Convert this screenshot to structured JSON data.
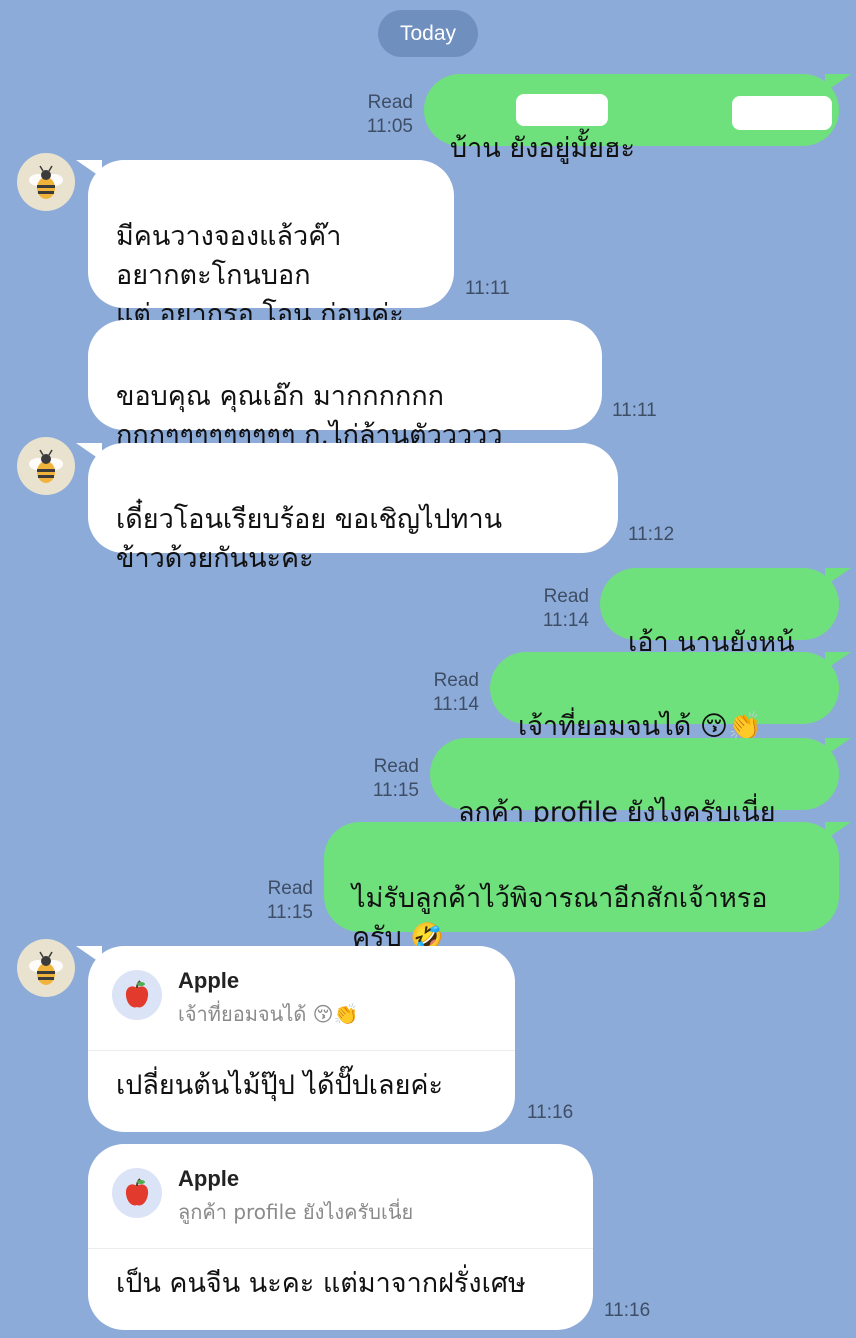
{
  "chat": {
    "date_label": "Today",
    "avatar_icon": "bee-avatar",
    "messages": [
      {
        "id": "m1",
        "direction": "out",
        "text": "บ้าน         ยังอยู่มั้ยฮะ",
        "status": "Read",
        "time": "11:05"
      },
      {
        "id": "m2",
        "direction": "in",
        "text": "มีคนวางจองแล้วค๊า\nอยากตะโกนบอก\nแต่ อยากรอ โอน ก่อนค่ะ",
        "time": "11:11"
      },
      {
        "id": "m3",
        "direction": "in",
        "text": "ขอบคุณ คุณเอ๊ก มากกกกกก\nกกกๆๆๆๆๆๆๆๆๆ ก.ไก่ล้านตัววววว",
        "time": "11:11"
      },
      {
        "id": "m4",
        "direction": "in",
        "text": "เดี๋ยวโอนเรียบร้อย        ขอเชิญไปทาน\nข้าวด้วยกันนะคะ",
        "time": "11:12"
      },
      {
        "id": "m5",
        "direction": "out",
        "text": "เอ้า นานยังหน้",
        "status": "Read",
        "time": "11:14"
      },
      {
        "id": "m6",
        "direction": "out",
        "text": "เจ้าที่ยอมจนได้ 😚👏",
        "status": "Read",
        "time": "11:14"
      },
      {
        "id": "m7",
        "direction": "out",
        "text": "ลูกค้า profile ยังไงครับเนี่ย",
        "status": "Read",
        "time": "11:15"
      },
      {
        "id": "m8",
        "direction": "out",
        "text": "ไม่รับลูกค้าไว้พิจารณาอีกสักเจ้าหรอ\nครับ 🤣",
        "status": "Read",
        "time": "11:15"
      },
      {
        "id": "m9",
        "direction": "in",
        "reply_name": "Apple",
        "reply_quote": "เจ้าที่ยอมจนได้ 😚👏",
        "text": "เปลี่ยนต้นไม้ปุ๊ป ได้ปั๊ปเลยค่ะ",
        "time": "11:16"
      },
      {
        "id": "m10",
        "direction": "in",
        "reply_name": "Apple",
        "reply_quote": "ลูกค้า profile ยังไงครับเนี่ย",
        "text": "เป็น คนจีน นะคะ แต่มาจากฝรั่งเศษ",
        "time": "11:16"
      }
    ]
  },
  "colors": {
    "background": "#8dabd8",
    "outgoing": "#6ee17c",
    "incoming": "#ffffff",
    "date_pill": "#6f8fbe"
  }
}
